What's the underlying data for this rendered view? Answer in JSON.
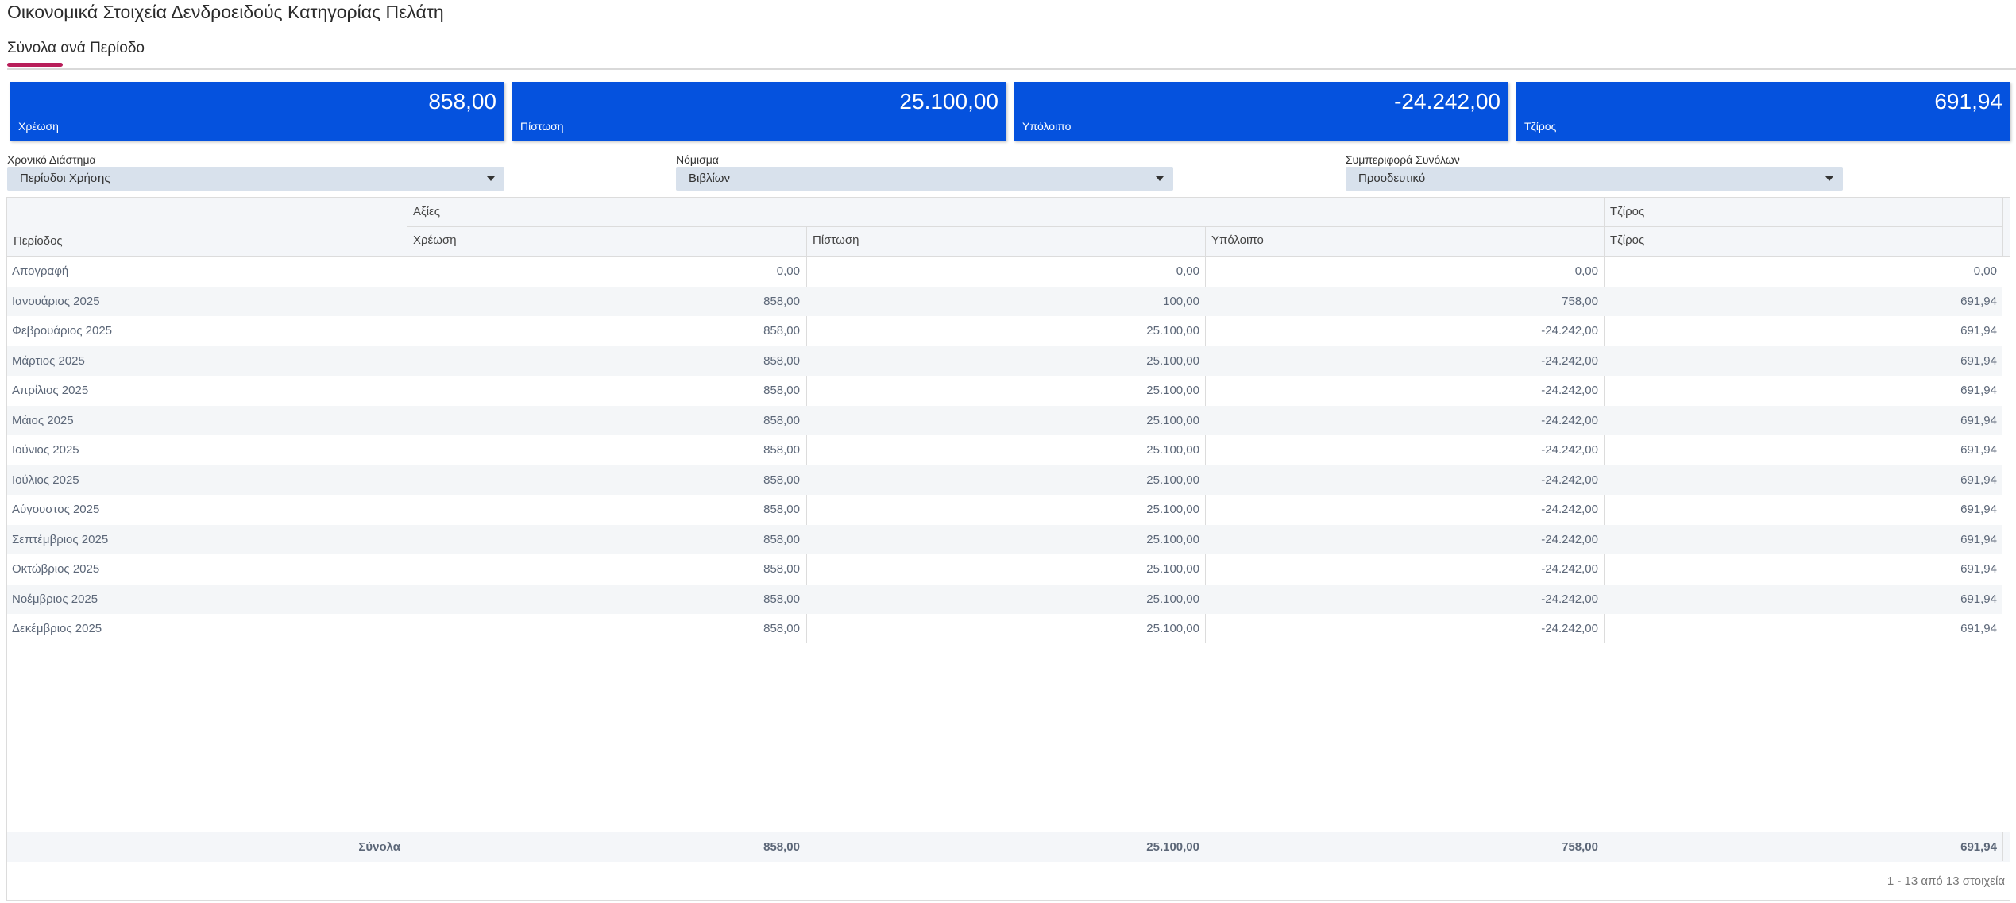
{
  "page": {
    "title": "Οικονομικά Στοιχεία Δενδροειδούς Κατηγορίας Πελάτη"
  },
  "tabs": [
    {
      "label": "Σύνολα ανά Περίοδο",
      "active": true
    }
  ],
  "kpis": [
    {
      "value": "858,00",
      "label": "Χρέωση"
    },
    {
      "value": "25.100,00",
      "label": "Πίστωση"
    },
    {
      "value": "-24.242,00",
      "label": "Υπόλοιπο"
    },
    {
      "value": "691,94",
      "label": "Τζίρος"
    }
  ],
  "filters": [
    {
      "label": "Χρονικό Διάστημα",
      "value": "Περίοδοι Χρήσης"
    },
    {
      "label": "Νόμισμα",
      "value": "Βιβλίων"
    },
    {
      "label": "Συμπεριφορά Συνόλων",
      "value": "Προοδευτικό"
    }
  ],
  "table": {
    "group_headers": {
      "values": "Αξίες",
      "turnover": "Τζίρος"
    },
    "columns": {
      "period": "Περίοδος",
      "debit": "Χρέωση",
      "credit": "Πίστωση",
      "balance": "Υπόλοιπο",
      "turnover": "Τζίρος"
    },
    "rows": [
      {
        "period": "Απογραφή",
        "debit": "0,00",
        "credit": "0,00",
        "balance": "0,00",
        "turnover": "0,00"
      },
      {
        "period": "Ιανουάριος 2025",
        "debit": "858,00",
        "credit": "100,00",
        "balance": "758,00",
        "turnover": "691,94"
      },
      {
        "period": "Φεβρουάριος 2025",
        "debit": "858,00",
        "credit": "25.100,00",
        "balance": "-24.242,00",
        "turnover": "691,94"
      },
      {
        "period": "Μάρτιος 2025",
        "debit": "858,00",
        "credit": "25.100,00",
        "balance": "-24.242,00",
        "turnover": "691,94"
      },
      {
        "period": "Απρίλιος 2025",
        "debit": "858,00",
        "credit": "25.100,00",
        "balance": "-24.242,00",
        "turnover": "691,94"
      },
      {
        "period": "Μάιος 2025",
        "debit": "858,00",
        "credit": "25.100,00",
        "balance": "-24.242,00",
        "turnover": "691,94"
      },
      {
        "period": "Ιούνιος 2025",
        "debit": "858,00",
        "credit": "25.100,00",
        "balance": "-24.242,00",
        "turnover": "691,94"
      },
      {
        "period": "Ιούλιος 2025",
        "debit": "858,00",
        "credit": "25.100,00",
        "balance": "-24.242,00",
        "turnover": "691,94"
      },
      {
        "period": "Αύγουστος 2025",
        "debit": "858,00",
        "credit": "25.100,00",
        "balance": "-24.242,00",
        "turnover": "691,94"
      },
      {
        "period": "Σεπτέμβριος 2025",
        "debit": "858,00",
        "credit": "25.100,00",
        "balance": "-24.242,00",
        "turnover": "691,94"
      },
      {
        "period": "Οκτώβριος 2025",
        "debit": "858,00",
        "credit": "25.100,00",
        "balance": "-24.242,00",
        "turnover": "691,94"
      },
      {
        "period": "Νοέμβριος 2025",
        "debit": "858,00",
        "credit": "25.100,00",
        "balance": "-24.242,00",
        "turnover": "691,94"
      },
      {
        "period": "Δεκέμβριος 2025",
        "debit": "858,00",
        "credit": "25.100,00",
        "balance": "-24.242,00",
        "turnover": "691,94"
      }
    ],
    "totals": {
      "label": "Σύνολα",
      "debit": "858,00",
      "credit": "25.100,00",
      "balance": "758,00",
      "turnover": "691,94"
    },
    "pager": "1 - 13 από 13 στοιχεία"
  }
}
